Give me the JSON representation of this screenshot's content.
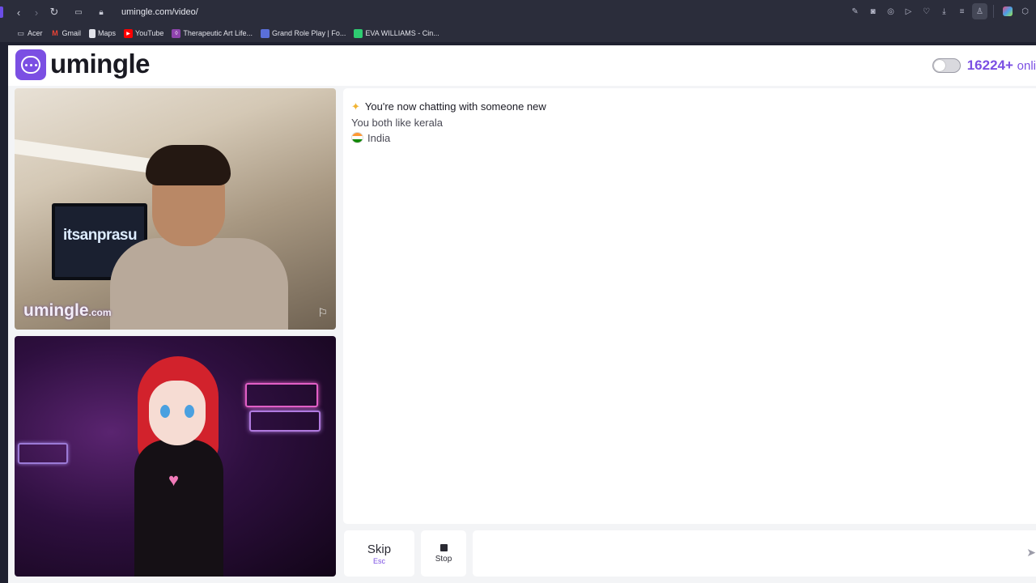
{
  "browser": {
    "url": "umingle.com/video/",
    "bookmarks": [
      {
        "label": "Acer",
        "icon": "folder-icon"
      },
      {
        "label": "Gmail",
        "icon": "gmail-icon"
      },
      {
        "label": "Maps",
        "icon": "bookmark-page-icon"
      },
      {
        "label": "YouTube",
        "icon": "youtube-icon"
      },
      {
        "label": "Therapeutic Art Life...",
        "icon": "site-icon"
      },
      {
        "label": "Grand Role Play | Fo...",
        "icon": "site-icon"
      },
      {
        "label": "EVA WILLIAMS - Cin...",
        "icon": "site-icon"
      }
    ]
  },
  "header": {
    "logo_text": "umingle",
    "online_count": "16224+",
    "online_suffix": "onli"
  },
  "videos": {
    "top_screen_text": "itsanprasu",
    "watermark_brand": "umingle",
    "watermark_domain": ".com"
  },
  "chat": {
    "title": "You're now chatting with someone new",
    "common_interest": "You both like kerala",
    "country": "India"
  },
  "controls": {
    "skip_label": "Skip",
    "skip_hint": "Esc",
    "stop_label": "Stop",
    "message_placeholder": ""
  },
  "colors": {
    "brand": "#7b4fe3",
    "browser_chrome": "#2b2d3b"
  }
}
